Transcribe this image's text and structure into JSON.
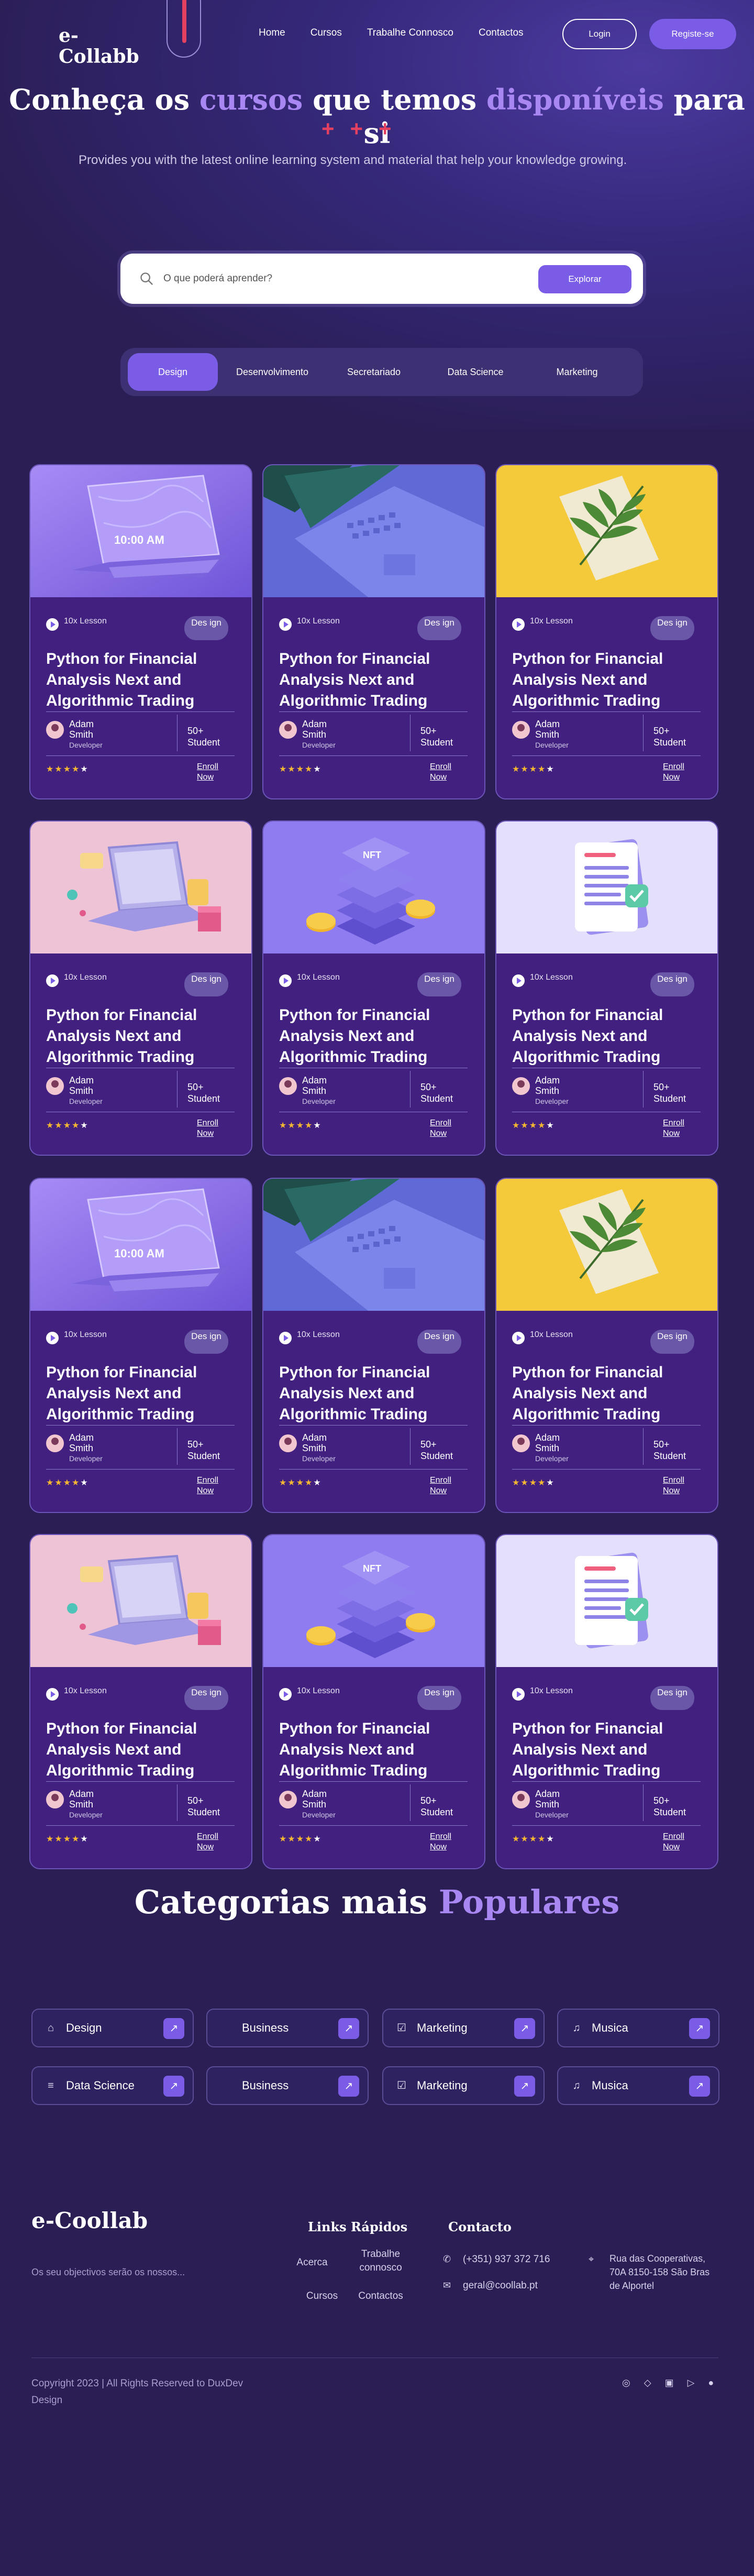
{
  "header": {
    "logo": "e-Collabb",
    "nav": [
      "Home",
      "Cursos",
      "Trabalhe Connosco",
      "Contactos"
    ],
    "login_label": "Login",
    "signup_label": "Registe-se"
  },
  "hero": {
    "title_part1": "Conheça os ",
    "title_accent1": "cursos",
    "title_part2": " que temos ",
    "title_accent2": "disponíveis",
    "title_part3": " para si",
    "subtitle": "Provides you with the latest online learning system and material that help your knowledge growing.",
    "search_placeholder": "O que poderá aprender?",
    "explore_label": "Explorar"
  },
  "tabs": [
    "Design",
    "Desenvolvimento",
    "Secretariado",
    "Data Science",
    "Marketing"
  ],
  "card": {
    "lessons": "10x Lesson",
    "tag": "Des ign",
    "title": "Python for Financial Analysis Next and Algorithmic Trading",
    "author": "Adam Smith",
    "role": "Developer",
    "students": "50+ Student",
    "rating": 4,
    "enroll": "Enroll Now"
  },
  "categories": {
    "title_part1": "Categorias mais ",
    "title_accent": "Populares",
    "items": [
      {
        "label": "Design",
        "icon": "building-icon"
      },
      {
        "label": "Business",
        "icon": ""
      },
      {
        "label": "Marketing",
        "icon": "checklist-icon"
      },
      {
        "label": "Musica",
        "icon": "music-note-icon"
      },
      {
        "label": "Data Science",
        "icon": "database-icon"
      },
      {
        "label": "Business",
        "icon": ""
      },
      {
        "label": "Marketing",
        "icon": "checklist-icon"
      },
      {
        "label": "Musica",
        "icon": "music-note-icon"
      }
    ]
  },
  "footer": {
    "logo": "e-Coollab",
    "description": "Os seu objectivos serão os nossos...",
    "quick_links_title": "Links Rápidos",
    "links": [
      "Acerca",
      "Trabalhe connosco",
      "Cursos",
      "Contactos"
    ],
    "contact_title": "Contacto",
    "phone": "(+351) 937 372 716",
    "email": "geral@coollab.pt",
    "address": "Rua das Cooperativas, 70A 8150-158 São Bras de Alportel",
    "copyright": "Copyright 2023 | All Rights Reserved to DuxDev Design"
  }
}
